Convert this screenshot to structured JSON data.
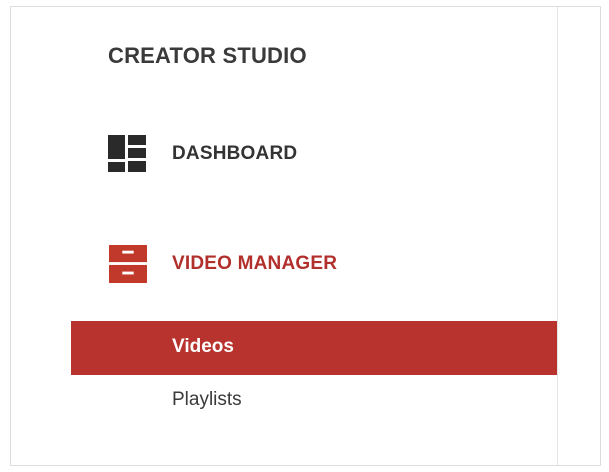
{
  "header": {
    "title": "CREATOR STUDIO"
  },
  "nav": {
    "dashboard": {
      "label": "DASHBOARD",
      "icon": "dashboard-icon"
    },
    "video_manager": {
      "label": "VIDEO MANAGER",
      "icon": "video-manager-icon",
      "subitems": [
        {
          "label": "Videos",
          "active": true
        },
        {
          "label": "Playlists",
          "active": false
        }
      ]
    }
  },
  "colors": {
    "accent": "#b8322e",
    "text_dark": "#333333",
    "active_label": "#b2302c"
  }
}
